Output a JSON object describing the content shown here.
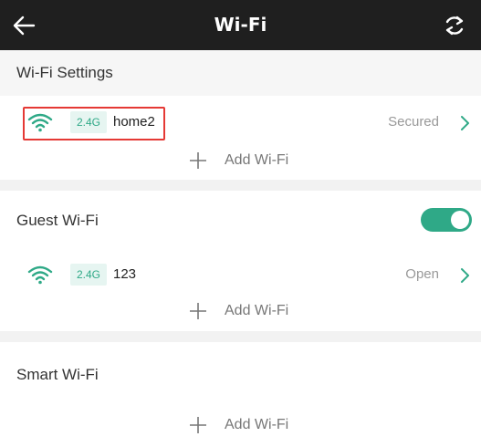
{
  "header": {
    "title": "Wi-Fi",
    "back_icon": "arrow-left-icon",
    "refresh_icon": "refresh-icon"
  },
  "wifi_settings": {
    "section_title": "Wi-Fi Settings",
    "networks": [
      {
        "band": "2.4G",
        "ssid": "home2",
        "security": "Secured"
      }
    ],
    "add_label": "Add Wi-Fi"
  },
  "guest_wifi": {
    "section_title": "Guest Wi-Fi",
    "enabled": true,
    "networks": [
      {
        "band": "2.4G",
        "ssid": "123",
        "security": "Open"
      }
    ],
    "add_label": "Add Wi-Fi"
  },
  "smart_wifi": {
    "section_title": "Smart Wi-Fi",
    "add_label": "Add Wi-Fi"
  },
  "colors": {
    "accent": "#2fa987",
    "header_bg": "#1f1f1f",
    "highlight_border": "#e53935",
    "badge_bg": "#e6f5f1"
  }
}
